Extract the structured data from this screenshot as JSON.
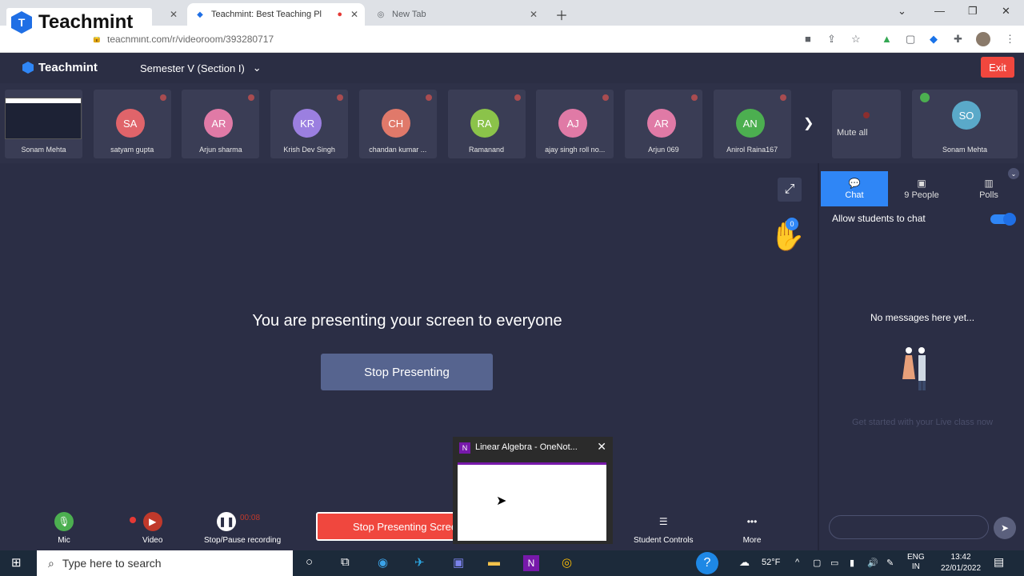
{
  "browser": {
    "tabs": [
      {
        "title": "",
        "active": false
      },
      {
        "title": "Teachmint: Best Teaching Pl",
        "active": true
      },
      {
        "title": "New Tab",
        "active": false
      }
    ],
    "url": "teachmint.com/r/videoroom/393280717"
  },
  "logo_overlay": {
    "text": "Teachmint"
  },
  "app": {
    "logo": "Teachmint",
    "class_name": "Semester V (Section I)",
    "exit_label": "Exit"
  },
  "participants": [
    {
      "name": "Sonam Mehta",
      "initials": "",
      "color": "#1d2235",
      "screen": true
    },
    {
      "name": "satyam gupta",
      "initials": "SA",
      "color": "#e0646a"
    },
    {
      "name": "Arjun sharma",
      "initials": "AR",
      "color": "#e07aa6"
    },
    {
      "name": "Krish Dev Singh",
      "initials": "KR",
      "color": "#9b7fe0"
    },
    {
      "name": "chandan kumar ...",
      "initials": "CH",
      "color": "#e0796a"
    },
    {
      "name": "Ramanand",
      "initials": "RA",
      "color": "#8bc34a"
    },
    {
      "name": "ajay singh roll no...",
      "initials": "AJ",
      "color": "#e07aa6"
    },
    {
      "name": "Arjun 069",
      "initials": "AR",
      "color": "#e07aa6"
    },
    {
      "name": "Anirol Raina167",
      "initials": "AN",
      "color": "#4caf50"
    }
  ],
  "host": {
    "name": "Sonam Mehta",
    "initials": "SO",
    "color": "#5aa9c9"
  },
  "mute_all_label": "Mute all",
  "main": {
    "present_message": "You are presenting your screen to everyone",
    "stop_presenting_label": "Stop Presenting",
    "hand_count": "0"
  },
  "side": {
    "tabs": [
      {
        "label": "Chat",
        "active": true
      },
      {
        "label": "9 People",
        "active": false
      },
      {
        "label": "Polls",
        "active": false
      }
    ],
    "allow_chat_label": "Allow students to chat",
    "no_messages": "No messages here yet...",
    "hint": "Get started with your Live class now"
  },
  "controls": {
    "mic": "Mic",
    "video": "Video",
    "record": "Stop/Pause recording",
    "record_time": "00:08",
    "stop_share": "Stop Presenting Screen",
    "student_controls": "Student Controls",
    "more": "More"
  },
  "preview": {
    "title": "Linear Algebra - OneNot..."
  },
  "taskbar": {
    "search_placeholder": "Type here to search",
    "weather": "52°F",
    "lang1": "ENG",
    "lang2": "IN",
    "time": "13:42",
    "date": "22/01/2022"
  }
}
